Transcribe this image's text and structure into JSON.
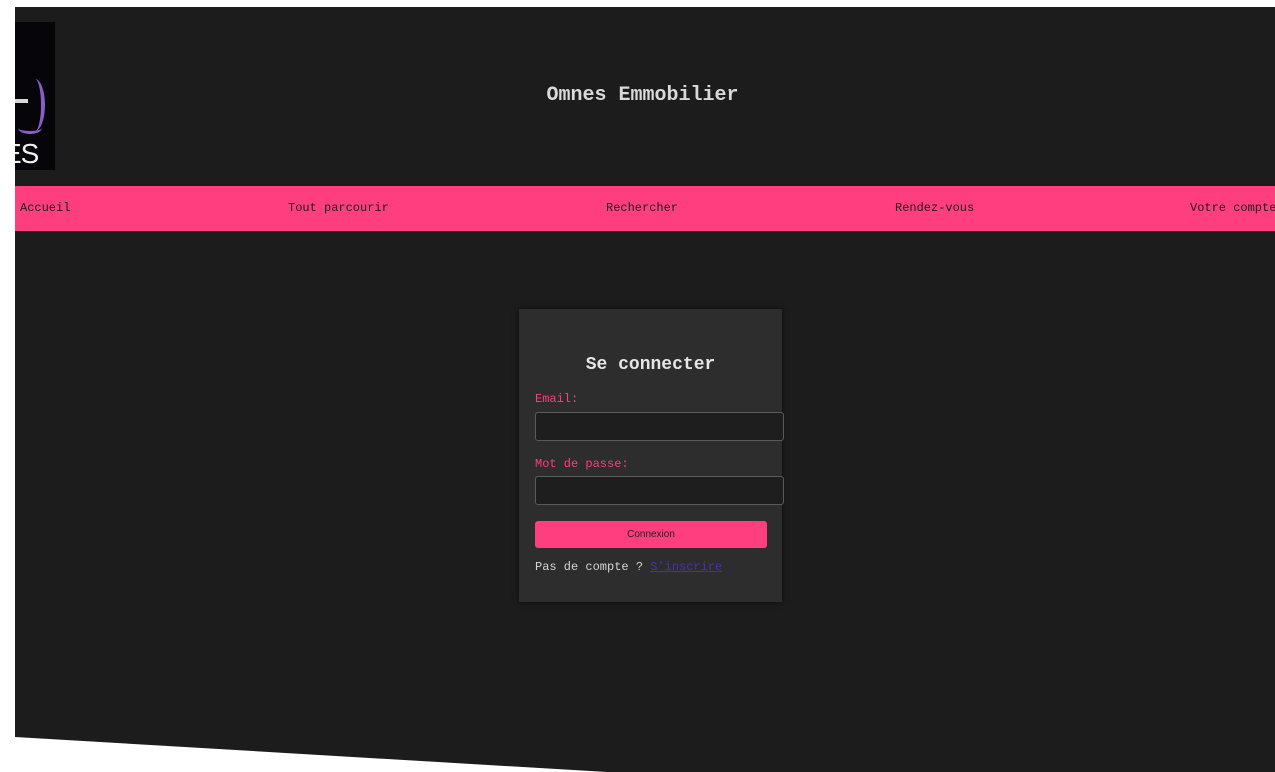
{
  "header": {
    "logo_text": "ES",
    "title": "Omnes Emmobilier"
  },
  "nav": {
    "items": [
      {
        "label": "Accueil"
      },
      {
        "label": "Tout parcourir"
      },
      {
        "label": "Rechercher"
      },
      {
        "label": "Rendez-vous"
      },
      {
        "label": "Votre compte"
      }
    ]
  },
  "login": {
    "title": "Se connecter",
    "email_label": "Email:",
    "email_value": "",
    "password_label": "Mot de passe:",
    "password_value": "",
    "submit_label": "Connexion",
    "signup_prompt": "Pas de compte ?",
    "signup_link": "S'inscrire"
  },
  "colors": {
    "background": "#1c1c1c",
    "accent": "#ff3e7f",
    "card": "#2d2d2d",
    "link": "#4b2fb3"
  }
}
